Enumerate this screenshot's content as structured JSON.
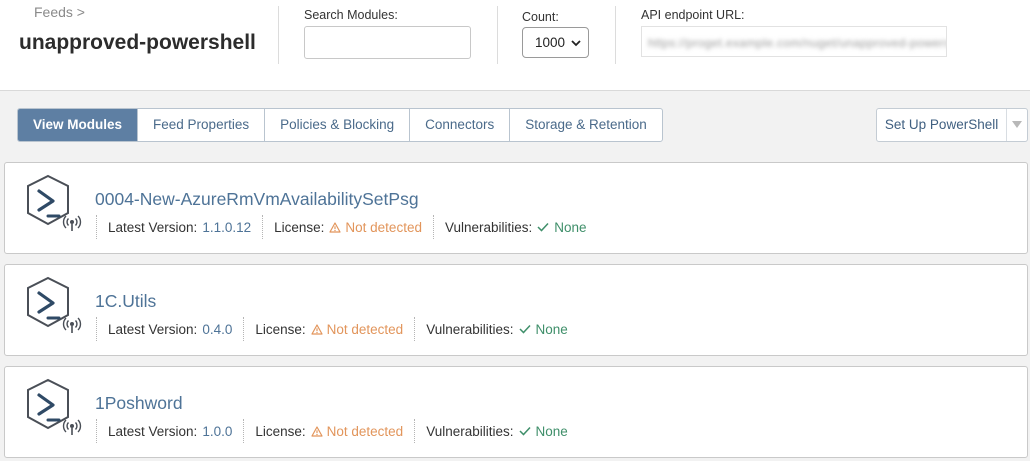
{
  "header": {
    "breadcrumb": "Feeds >",
    "feed_name": "unapproved-powershell",
    "search": {
      "label": "Search Modules:",
      "value": "",
      "placeholder": ""
    },
    "count": {
      "label": "Count:",
      "selected": "1000"
    },
    "api": {
      "label": "API endpoint URL:",
      "value": "https://proget.example.com/nuget/unapproved-powershell/"
    }
  },
  "tabs": [
    {
      "label": "View Modules",
      "active": true
    },
    {
      "label": "Feed Properties",
      "active": false
    },
    {
      "label": "Policies & Blocking",
      "active": false
    },
    {
      "label": "Connectors",
      "active": false
    },
    {
      "label": "Storage & Retention",
      "active": false
    }
  ],
  "setup_button": {
    "label": "Set Up PowerShell"
  },
  "labels": {
    "latest_version": "Latest Version:",
    "license": "License:",
    "vulnerabilities": "Vulnerabilities:"
  },
  "modules": [
    {
      "name": "0004-New-AzureRmVmAvailabilitySetPsg",
      "version": "1.1.0.12",
      "license": "Not detected",
      "vulnerabilities": "None"
    },
    {
      "name": "1C.Utils",
      "version": "0.4.0",
      "license": "Not detected",
      "vulnerabilities": "None"
    },
    {
      "name": "1Poshword",
      "version": "1.0.0",
      "license": "Not detected",
      "vulnerabilities": "None"
    }
  ],
  "colors": {
    "accent": "#5e7fa3",
    "link": "#4e7397",
    "warning": "#e2955b",
    "success": "#3f8f6a"
  }
}
